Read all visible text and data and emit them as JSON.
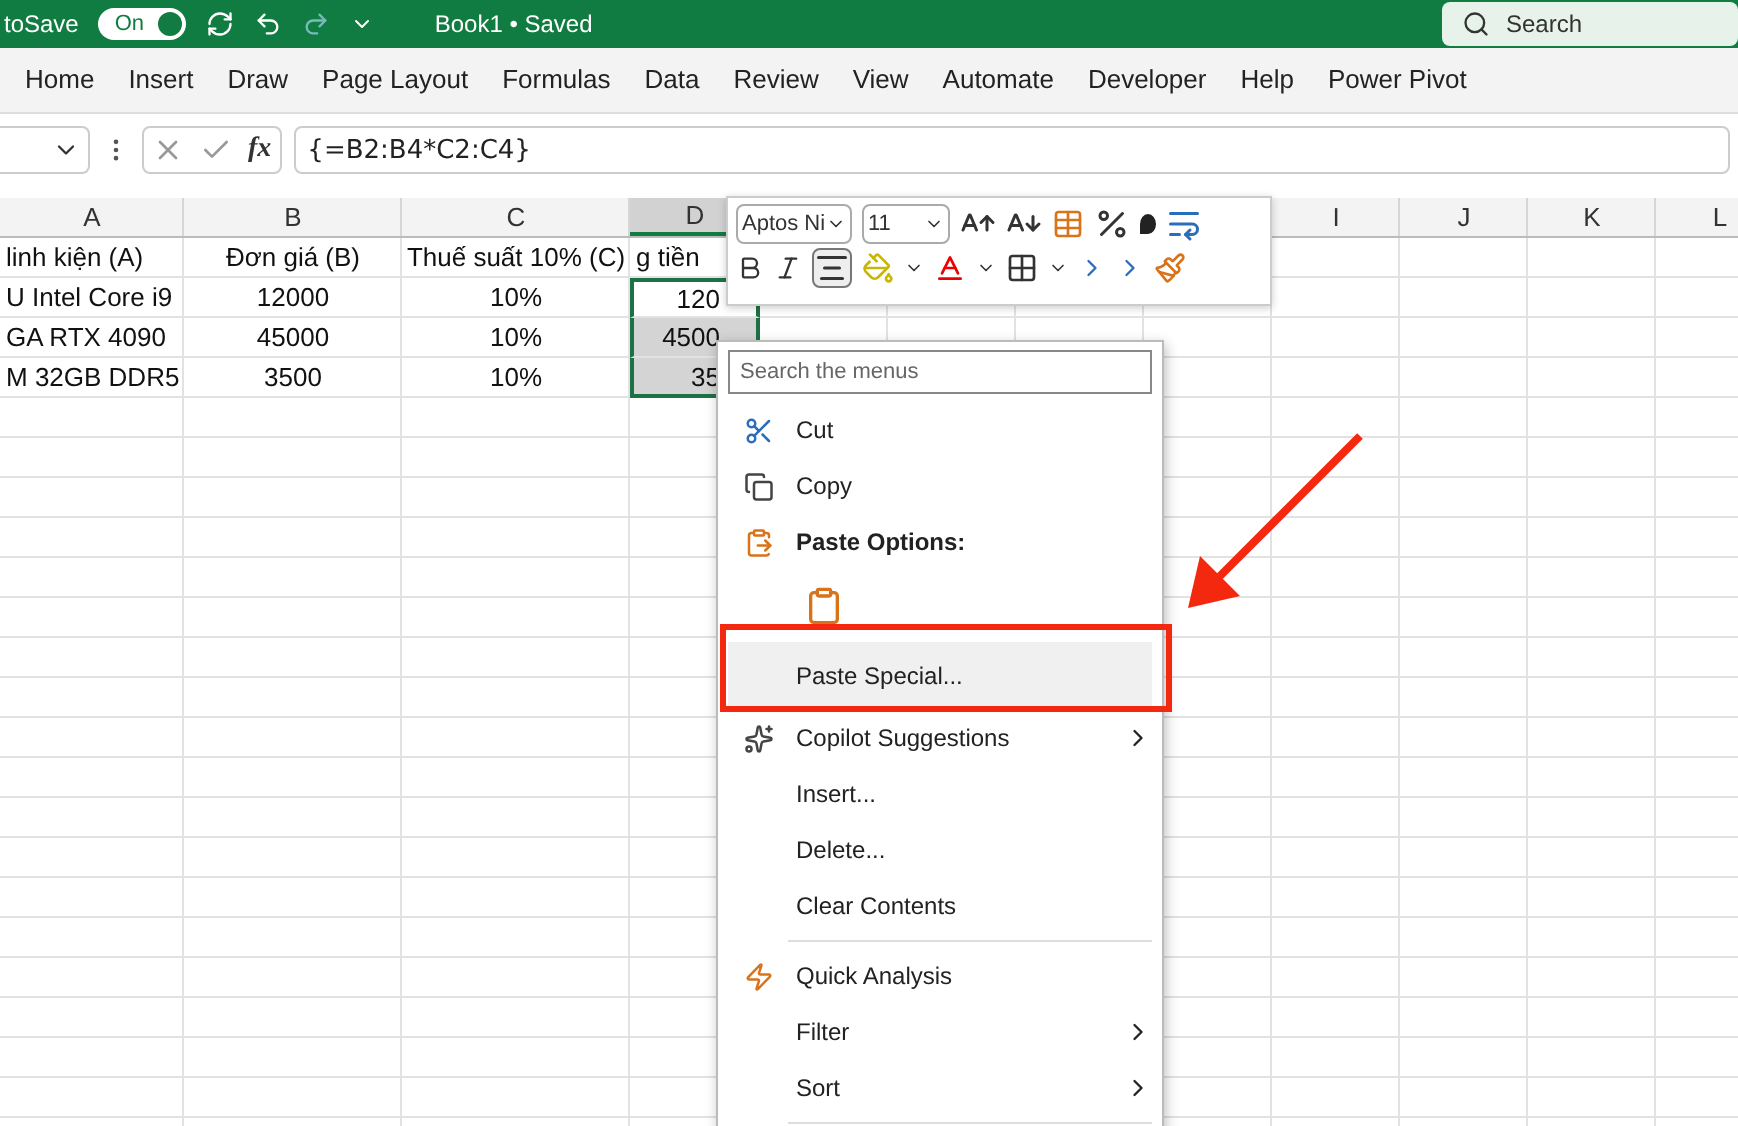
{
  "title_bar": {
    "autosave_label": "toSave",
    "autosave_toggle": {
      "label": "On",
      "on": true
    },
    "document_title": "Book1 • Saved",
    "search": {
      "placeholder": "Search"
    }
  },
  "ribbon_tabs": [
    {
      "label": "Home",
      "selected": false
    },
    {
      "label": "Insert",
      "selected": false
    },
    {
      "label": "Draw",
      "selected": false
    },
    {
      "label": "Page Layout",
      "selected": false
    },
    {
      "label": "Formulas",
      "selected": false
    },
    {
      "label": "Data",
      "selected": false
    },
    {
      "label": "Review",
      "selected": false
    },
    {
      "label": "View",
      "selected": false
    },
    {
      "label": "Automate",
      "selected": false
    },
    {
      "label": "Developer",
      "selected": false
    },
    {
      "label": "Help",
      "selected": false
    },
    {
      "label": "Power Pivot",
      "selected": false
    }
  ],
  "formula_bar": {
    "function_label": "fx",
    "formula": "{=B2:B4*C2:C4}"
  },
  "sheet": {
    "columns": [
      {
        "label": "A",
        "selected": false
      },
      {
        "label": "B",
        "selected": false
      },
      {
        "label": "C",
        "selected": false
      },
      {
        "label": "D",
        "selected": true
      },
      {
        "label": "I",
        "selected": false
      },
      {
        "label": "J",
        "selected": false
      },
      {
        "label": "K",
        "selected": false
      },
      {
        "label": "L",
        "selected": false
      }
    ],
    "rows": [
      {
        "cells": [
          "linh kiện (A)",
          "Đơn giá (B)",
          "Thuế suất 10% (C)",
          "g tiền"
        ],
        "selected": false
      },
      {
        "cells": [
          "U Intel Core i9",
          "12000",
          "10%",
          "120"
        ],
        "selected": true
      },
      {
        "cells": [
          "GA RTX 4090",
          "45000",
          "10%",
          "4500"
        ],
        "selected": true
      },
      {
        "cells": [
          "M 32GB DDR5",
          "3500",
          "10%",
          "35"
        ],
        "selected": true
      }
    ]
  },
  "mini_toolbar": {
    "font": "Aptos Ni",
    "size": "11"
  },
  "context_menu": {
    "search": {
      "placeholder": "Search the menus"
    },
    "items": [
      {
        "kind": "item",
        "label": "Cut",
        "submenu": false,
        "highlighted": false
      },
      {
        "kind": "item",
        "label": "Copy",
        "submenu": false,
        "highlighted": false
      },
      {
        "kind": "header",
        "label": "Paste Options:"
      },
      {
        "kind": "paste-option"
      },
      {
        "kind": "item",
        "label": "Paste Special...",
        "submenu": false,
        "highlighted": true
      },
      {
        "kind": "item",
        "label": "Copilot Suggestions",
        "submenu": true,
        "highlighted": false
      },
      {
        "kind": "item",
        "label": "Insert...",
        "submenu": false,
        "highlighted": false
      },
      {
        "kind": "item",
        "label": "Delete...",
        "submenu": false,
        "highlighted": false
      },
      {
        "kind": "item",
        "label": "Clear Contents",
        "submenu": false,
        "highlighted": false
      },
      {
        "kind": "separator"
      },
      {
        "kind": "item",
        "label": "Quick Analysis",
        "submenu": false,
        "highlighted": false
      },
      {
        "kind": "item",
        "label": "Filter",
        "submenu": true,
        "highlighted": false
      },
      {
        "kind": "item",
        "label": "Sort",
        "submenu": true,
        "highlighted": false
      },
      {
        "kind": "separator"
      }
    ]
  }
}
